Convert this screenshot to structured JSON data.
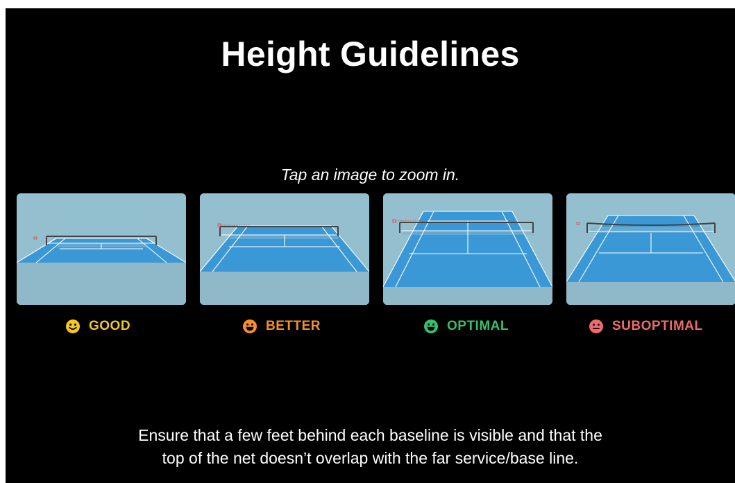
{
  "title": "Height Guidelines",
  "hint": "Tap an image to zoom in.",
  "options": [
    {
      "label": "GOOD",
      "color": "#f3c623",
      "face": "smile"
    },
    {
      "label": "BETTER",
      "color": "#f5902b",
      "face": "grin"
    },
    {
      "label": "OPTIMAL",
      "color": "#34c06a",
      "face": "grin"
    },
    {
      "label": "SUBOPTIMAL",
      "color": "#f06a6a",
      "face": "neutral"
    }
  ],
  "footer": {
    "line1": "Ensure that a few feet behind each baseline is visible and that the",
    "line2": "top of the net doesn’t overlap with the far service/base line."
  },
  "colors": {
    "background": "#000000",
    "court_surround": "#94bfcf",
    "court": "#3b98d6",
    "court_lines": "#ffffff"
  }
}
